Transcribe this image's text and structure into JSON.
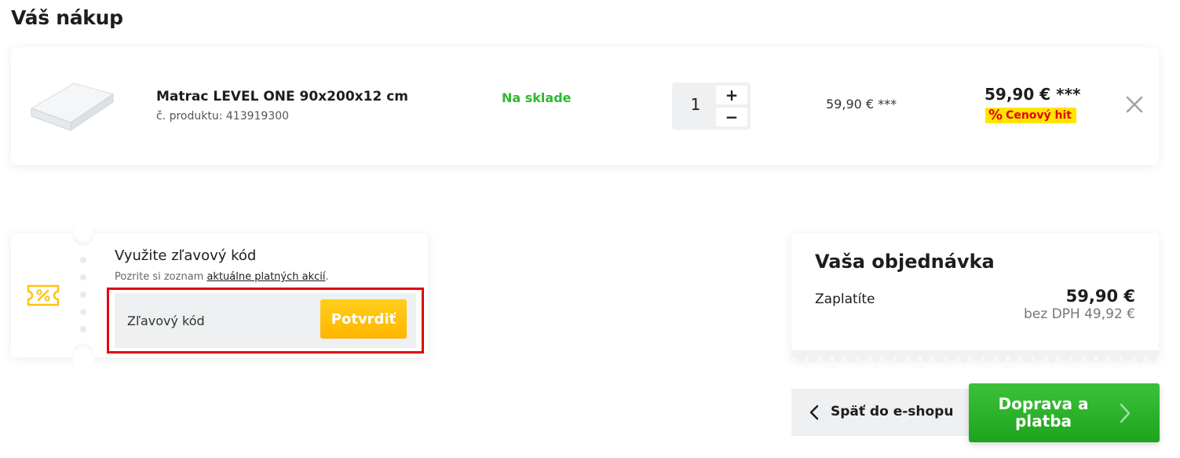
{
  "page": {
    "title": "Váš nákup"
  },
  "cart": {
    "items": [
      {
        "name": "Matrac LEVEL ONE 90x200x12 cm",
        "code": "č. produktu: 413919300",
        "stock": "Na sklade",
        "quantity": "1",
        "unit_price": "59,90 € ***",
        "total_price": "59,90 € ***",
        "badge": "Cenový hit",
        "badge_icon": "%"
      }
    ],
    "qty_plus": "+",
    "qty_minus": "−"
  },
  "discount": {
    "title": "Využite zľavový kód",
    "subtitle_prefix": "Pozrite si zoznam ",
    "subtitle_link": "aktuálne platných akcií",
    "subtitle_suffix": ".",
    "input_placeholder": "Zľavový kód",
    "confirm_label": "Potvrdiť"
  },
  "summary": {
    "title": "Vaša objednávka",
    "pay_label": "Zaplatíte",
    "total": "59,90 €",
    "net": "bez DPH 49,92 €"
  },
  "nav": {
    "back_label": "Späť do e-shopu",
    "next_label": "Doprava a platba"
  },
  "colors": {
    "in_stock": "#2eb82e",
    "badge_bg": "#ffe500",
    "badge_text": "#e3000f",
    "confirm_button": "#ffb400",
    "next_button": "#1ea31e",
    "highlight_frame": "#e3000f"
  },
  "icons": {
    "remove": "close-icon",
    "coupon": "coupon-icon",
    "back": "chevron-left-icon",
    "next": "chevron-right-icon"
  }
}
